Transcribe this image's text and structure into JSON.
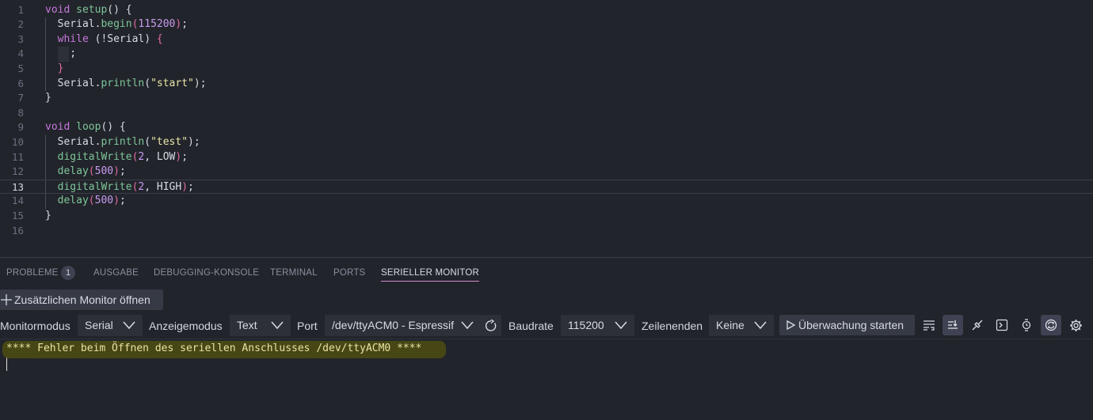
{
  "editor": {
    "active_line": 13,
    "lines": [
      {
        "n": "1",
        "tokens": [
          [
            "k",
            "void"
          ],
          [
            "",
            ""
          ],
          [
            "f",
            " setup"
          ],
          [
            "",
            "() {"
          ]
        ]
      },
      {
        "n": "2",
        "tokens": [
          [
            "",
            "  Serial."
          ],
          [
            "f",
            "begin"
          ],
          [
            "p",
            "("
          ],
          [
            "n",
            "115200"
          ],
          [
            "p",
            ")"
          ],
          [
            "",
            ";"
          ]
        ]
      },
      {
        "n": "3",
        "tokens": [
          [
            "",
            "  "
          ],
          [
            "k",
            "while"
          ],
          [
            "",
            " (!Serial) "
          ],
          [
            "p",
            "{"
          ]
        ]
      },
      {
        "n": "4",
        "tokens": [
          [
            "",
            "    ;"
          ]
        ]
      },
      {
        "n": "5",
        "tokens": [
          [
            "",
            "  "
          ],
          [
            "p",
            "}"
          ]
        ]
      },
      {
        "n": "6",
        "tokens": [
          [
            "",
            "  Serial."
          ],
          [
            "f",
            "println"
          ],
          [
            "",
            "("
          ],
          [
            "s",
            "\"start\""
          ],
          [
            "",
            ");"
          ]
        ]
      },
      {
        "n": "7",
        "tokens": [
          [
            "",
            "}"
          ]
        ]
      },
      {
        "n": "8",
        "tokens": []
      },
      {
        "n": "9",
        "tokens": [
          [
            "k",
            "void"
          ],
          [
            "f",
            " loop"
          ],
          [
            "",
            "() {"
          ]
        ]
      },
      {
        "n": "10",
        "tokens": [
          [
            "",
            "  Serial."
          ],
          [
            "f",
            "println"
          ],
          [
            "",
            "("
          ],
          [
            "s",
            "\"test\""
          ],
          [
            "",
            ");"
          ]
        ]
      },
      {
        "n": "11",
        "tokens": [
          [
            "",
            "  "
          ],
          [
            "f",
            "digitalWrite"
          ],
          [
            "p",
            "("
          ],
          [
            "n",
            "2"
          ],
          [
            "",
            ", LOW"
          ],
          [
            "p",
            ")"
          ],
          [
            "",
            ";"
          ]
        ]
      },
      {
        "n": "12",
        "tokens": [
          [
            "",
            "  "
          ],
          [
            "f",
            "delay"
          ],
          [
            "p",
            "("
          ],
          [
            "n",
            "500"
          ],
          [
            "p",
            ")"
          ],
          [
            "",
            ";"
          ]
        ]
      },
      {
        "n": "13",
        "tokens": [
          [
            "",
            "  "
          ],
          [
            "f",
            "digitalWrite"
          ],
          [
            "p",
            "("
          ],
          [
            "n",
            "2"
          ],
          [
            "",
            ", HIGH"
          ],
          [
            "p",
            ")"
          ],
          [
            "",
            ";"
          ]
        ]
      },
      {
        "n": "14",
        "tokens": [
          [
            "",
            "  "
          ],
          [
            "f",
            "delay"
          ],
          [
            "p",
            "("
          ],
          [
            "n",
            "500"
          ],
          [
            "p",
            ")"
          ],
          [
            "",
            ";"
          ]
        ]
      },
      {
        "n": "15",
        "tokens": [
          [
            "",
            "}"
          ]
        ]
      },
      {
        "n": "16",
        "tokens": []
      }
    ]
  },
  "panel": {
    "tabs": {
      "problems": "PROBLEME",
      "problems_count": "1",
      "output": "AUSGABE",
      "debug_console": "DEBUGGING-KONSOLE",
      "terminal": "TERMINAL",
      "ports": "PORTS",
      "serial_monitor": "SERIELLER MONITOR"
    },
    "open_monitor_button": "Zusätzlichen Monitor öffnen",
    "toolbar": {
      "monitor_mode_label": "Monitormodus",
      "monitor_mode_value": "Serial",
      "display_mode_label": "Anzeigemodus",
      "display_mode_value": "Text",
      "port_label": "Port",
      "port_value": "/dev/ttyACM0 - Espressif",
      "baud_label": "Baudrate",
      "baud_value": "115200",
      "line_ending_label": "Zeilenenden",
      "line_ending_value": "Keine",
      "start_button": "Überwachung starten"
    },
    "output_text": "**** Fehler beim Öffnen des seriellen Anschlusses /dev/ttyACM0 ****"
  },
  "colors": {
    "background": "#22242b",
    "accent_tab_underline": "#d18ac8",
    "error_text": "#e8e2a0",
    "error_highlight": "#4e4d12"
  }
}
